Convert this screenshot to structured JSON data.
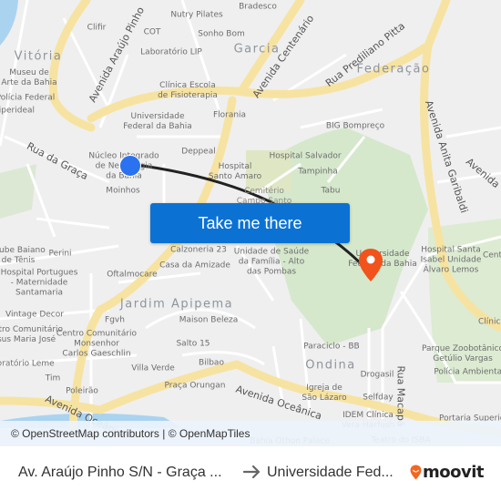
{
  "map": {
    "neighborhoods": [
      "Vitória",
      "Garcia",
      "Federação",
      "Jardim Apipema",
      "Ondina"
    ],
    "roads": [
      "Avenida Araújo Pinho",
      "Avenida Centenário",
      "Rua Prediliano Pitta",
      "Rua da Graça",
      "Avenida Anita Garibaldi",
      "Avenida Oceânica",
      "Avenida Oceânica",
      "Rua Macapá",
      "Avenida"
    ],
    "pois": [
      "Nutry Pilates",
      "Bradesco",
      "Clifir",
      "COT",
      "Sonho Bom",
      "Laboratório LIP",
      "Museu de\nArte da Bahia",
      "Polícia Federal",
      "Hiperideal",
      "Clínica Escola\nde Fisioterapia",
      "Universidade\nFederal da Bahia",
      "Florania",
      "BIG Bompreço",
      "Deppeal",
      "Núcleo Integrado\nde Neurologia\nda Bahia",
      "Moinhos",
      "Hospital\nSanto Amaro",
      "Hospital Salvador",
      "Tampinha",
      "Tabu",
      "Cemitério\nCampo Santo",
      "Clube Baiano\nde Tênis",
      "Perini",
      "Hospital Portugues\n- Maternidade\nSantamaria",
      "Calzoneria 23",
      "Casa da Amizade",
      "Unidade de Saúde\nda Família - Alto\ndas Pombas",
      "Oftalmocare",
      "Universidade\nFederal da Bahia",
      "Hospital Santa\nIsabel Unidade\nÁlvaro Lemos",
      "Centro",
      "Vintage Decor",
      "Centro Comunitário\nJesus Maria José",
      "Fgvh",
      "Maison Beleza",
      "Centro Comunitário\nMonsenhor\nCarlos Gaeschlin",
      "Salto 15",
      "Laboratório Leme",
      "Villa Verde",
      "Bilbao",
      "Tim",
      "Poleirão",
      "Praça Orungan",
      "Paraciclo - BB",
      "Drogasil",
      "Igreja de\nSão Lázaro",
      "Selfday",
      "IDEM Clínica\nVera Harfush",
      "Parque Zoobotânico\nGetúlio Vargas",
      "Polícia Ambiental",
      "Portaria Superior",
      "Teatro do ISBA",
      "Bahia Othon Palace",
      "Clínica"
    ],
    "origin_marker": "origin-dot",
    "destination_marker": "destination-pin",
    "route_color": "#222222",
    "attribution": "© OpenStreetMap contributors | © OpenMapTiles"
  },
  "cta": {
    "label": "Take me there",
    "color": "#0b72d4"
  },
  "footer": {
    "from": "Av. Araújo Pinho S/N - Graça ...",
    "to": "Universidade Fed...",
    "brand": "moovit",
    "brand_color": "#f26722"
  }
}
